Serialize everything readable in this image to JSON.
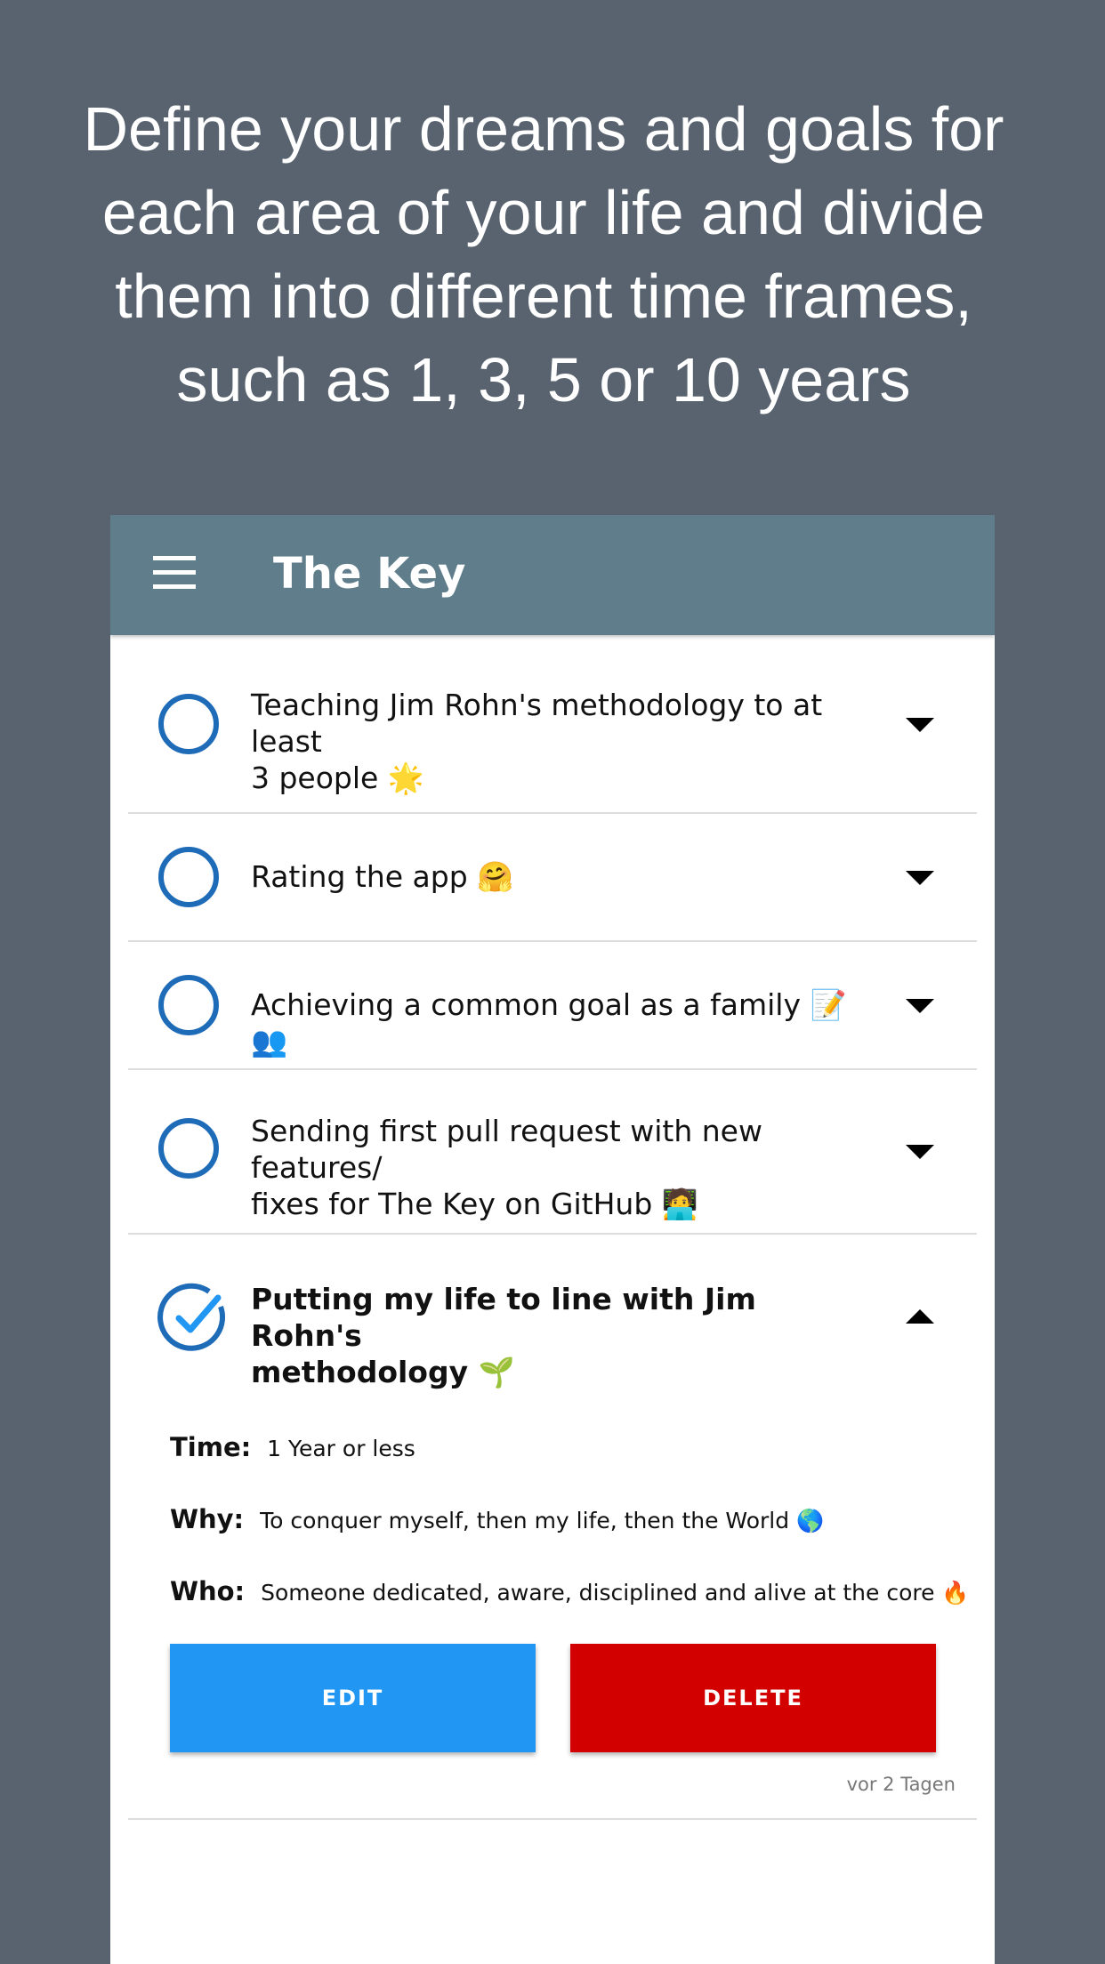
{
  "headline": {
    "line1": "Define your dreams and goals for",
    "line2": "each area of your life and divide",
    "line3": "them into different time frames,",
    "line4": "such as 1, 3, 5 or 10 years"
  },
  "app": {
    "title": "The Key",
    "header_color": "#607d8b",
    "accent_color": "#1e6bb8"
  },
  "goals": [
    {
      "text_line1": "Teaching Jim Rohn's methodology to at least",
      "text_line2": "3 people 🌟",
      "done": false
    },
    {
      "text_line1": "Rating the app 🤗",
      "done": false
    },
    {
      "text_line1": "Achieving a common goal as a family 📝👥",
      "done": false
    },
    {
      "text_line1": "Sending first pull request with new features/",
      "text_line2": "fixes for The Key on GitHub 🧑‍💻",
      "done": false
    },
    {
      "text_line1": "Putting my life to line with Jim Rohn's",
      "text_line2": "methodology 🌱",
      "done": true,
      "expanded": true,
      "details": {
        "time_label": "Time:",
        "time_value": "1 Year or less",
        "why_label": "Why:",
        "why_value": "To conquer myself, then my life, then the World 🌎",
        "who_label": "Who:",
        "who_value": "Someone dedicated, aware, disciplined and alive at the core 🔥"
      },
      "edit_label": "EDIT",
      "delete_label": "DELETE",
      "timestamp": "vor 2 Tagen"
    }
  ]
}
